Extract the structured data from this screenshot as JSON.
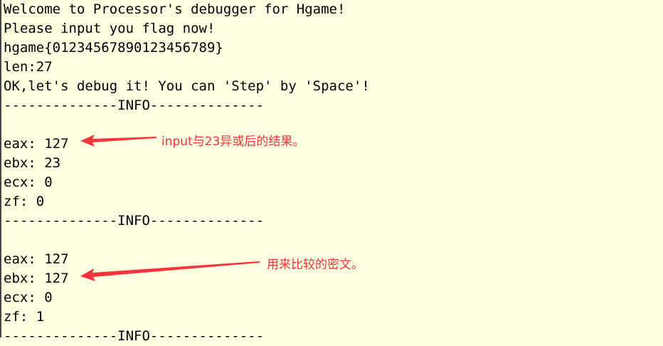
{
  "terminal": {
    "lines": [
      "Welcome to Processor's debugger for Hgame!",
      "Please input you flag now!",
      "hgame{01234567890123456789}",
      "len:27",
      "OK,let's debug it! You can 'Step' by 'Space'!",
      "--------------INFO--------------",
      "",
      "eax: 127",
      "ebx: 23",
      "ecx: 0",
      "zf: 0",
      "--------------INFO--------------",
      "",
      "eax: 127",
      "ebx: 127",
      "ecx: 0",
      "zf: 1",
      "--------------INFO--------------"
    ]
  },
  "annotations": [
    {
      "text": "input与23异或后的结果。"
    },
    {
      "text": "用来比较的密文。"
    }
  ],
  "colors": {
    "background": "#ffffe1",
    "annotation": "#f5333b"
  }
}
